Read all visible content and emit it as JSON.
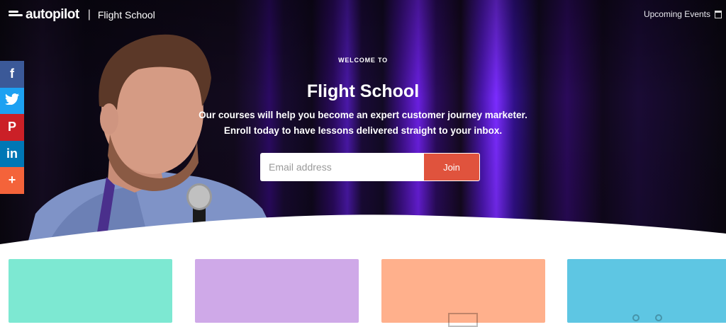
{
  "brand": {
    "logo_text": "autopilot",
    "separator": "|",
    "section": "Flight School"
  },
  "header": {
    "upcoming_events": "Upcoming Events"
  },
  "social": [
    {
      "name": "facebook",
      "glyph": "f",
      "color": "#3b5998"
    },
    {
      "name": "twitter",
      "glyph": "t",
      "color": "#1da1f2"
    },
    {
      "name": "pinterest",
      "glyph": "P",
      "color": "#cb2027"
    },
    {
      "name": "linkedin",
      "glyph": "in",
      "color": "#0077b5"
    },
    {
      "name": "more",
      "glyph": "+",
      "color": "#f4633a"
    }
  ],
  "hero": {
    "eyebrow": "WELCOME TO",
    "title": "Flight School",
    "line1": "Our courses will help you become an expert customer journey marketer.",
    "line2": "Enroll today to have lessons delivered straight to your inbox."
  },
  "signup": {
    "email_placeholder": "Email address",
    "join_label": "Join"
  },
  "cards": [
    {
      "color": "#7de8d2"
    },
    {
      "color": "#cfa9e8"
    },
    {
      "color": "#ffb08c"
    },
    {
      "color": "#5ec6e3"
    }
  ]
}
